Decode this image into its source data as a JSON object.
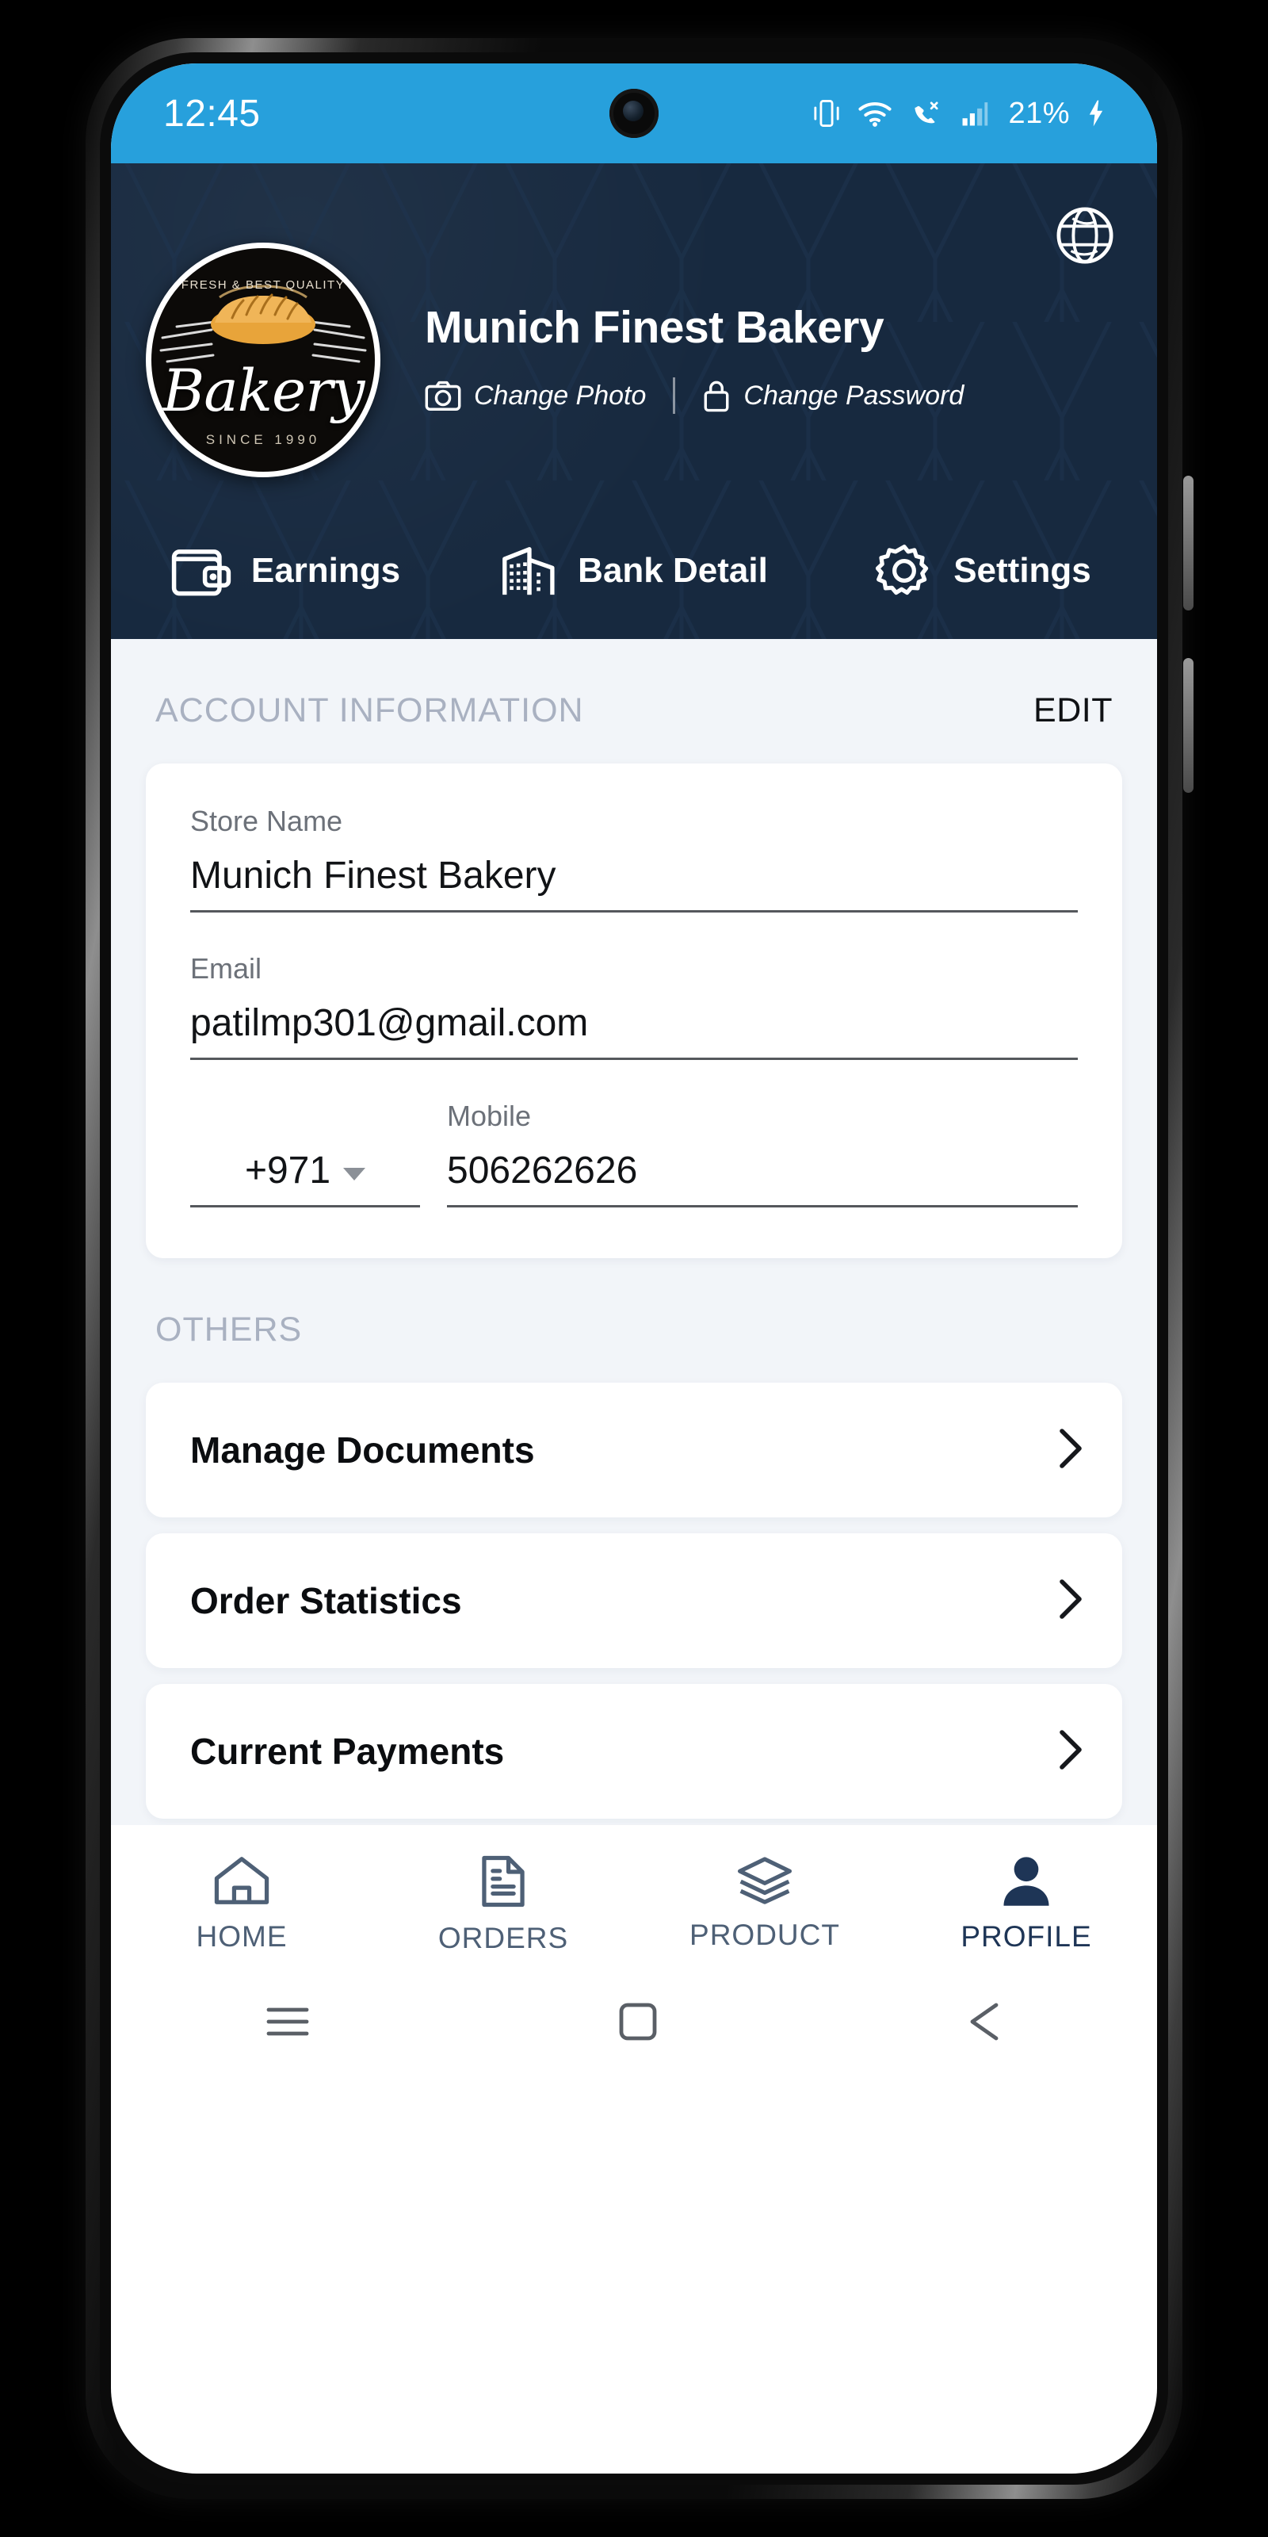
{
  "statusbar": {
    "time": "12:45",
    "battery": "21%",
    "icons": [
      "vibrate-icon",
      "wifi-icon",
      "missed-call-icon",
      "signal-icon",
      "charging-bolt-icon"
    ]
  },
  "header": {
    "store_title": "Munich Finest Bakery",
    "globe_icon": "globe-icon",
    "logo": {
      "brand_word": "Bakery",
      "top_text": "FRESH & BEST QUALITY",
      "bottom_text": "SINCE 1990",
      "icon": "bread-loaf-icon"
    },
    "actions": [
      {
        "label": "Change Photo",
        "icon": "camera-icon"
      },
      {
        "label": "Change Password",
        "icon": "lock-icon"
      }
    ],
    "tabs": [
      {
        "label": "Earnings",
        "icon": "wallet-icon"
      },
      {
        "label": "Bank Detail",
        "icon": "building-icon"
      },
      {
        "label": "Settings",
        "icon": "gear-icon"
      }
    ],
    "bg_color": "#17293F"
  },
  "account_section": {
    "title": "ACCOUNT INFORMATION",
    "edit_label": "EDIT",
    "fields": {
      "store_name": {
        "label": "Store Name",
        "value": "Munich Finest Bakery"
      },
      "email": {
        "label": "Email",
        "value": "patilmp301@gmail.com"
      },
      "country_code": {
        "value": "+971"
      },
      "mobile": {
        "label": "Mobile",
        "value": "506262626"
      }
    }
  },
  "others_section": {
    "title": "OTHERS",
    "items": [
      {
        "label": "Manage Documents",
        "chevron": "chevron-right-icon"
      },
      {
        "label": "Order Statistics",
        "chevron": "chevron-right-icon"
      },
      {
        "label": "Current Payments",
        "chevron": "chevron-right-icon"
      }
    ]
  },
  "bottom_nav": {
    "items": [
      {
        "label": "HOME",
        "icon": "home-icon",
        "active": false
      },
      {
        "label": "ORDERS",
        "icon": "document-icon",
        "active": false
      },
      {
        "label": "PRODUCT",
        "icon": "layers-icon",
        "active": false
      },
      {
        "label": "PROFILE",
        "icon": "person-icon",
        "active": true
      }
    ]
  },
  "system_nav": {
    "items": [
      "menu-icon",
      "home-square-icon",
      "back-triangle-icon"
    ]
  },
  "colors": {
    "status_blue": "#27A0DC",
    "header_navy": "#17293F",
    "body_bg": "#F2F5F9",
    "nav_icon": "#4E6076",
    "nav_active": "#1E3556"
  }
}
